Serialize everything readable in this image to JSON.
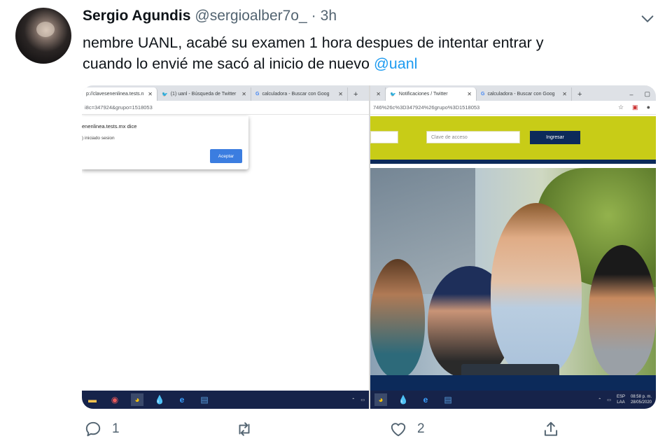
{
  "tweet": {
    "author_name": "Sergio Agundis",
    "handle": "@sergioalber7o_",
    "separator": "·",
    "time": "3h",
    "text_line1": "nembre UANL, acabé su examen 1 hora despues de intentar entrar y",
    "text_line2": "cuando lo envié me sacó al inicio de nuevo",
    "mention": "@uanl"
  },
  "left_screenshot": {
    "tabs": [
      {
        "label": "p://clavesenenlinea.tests.n"
      },
      {
        "label": "(1) uanl - Búsqueda de Twitter"
      },
      {
        "label": "calculadora - Buscar con Goog"
      }
    ],
    "new_tab": "+",
    "address": "i8c=347924&grupo=1518053",
    "dialog": {
      "title": "enenlinea.tests.mx dice",
      "message": ") iniciado sesion",
      "button": "Aceptar"
    }
  },
  "right_screenshot": {
    "tabs": [
      {
        "label": "Notificaciones / Twitter"
      },
      {
        "label": "calculadora - Buscar con Goog"
      }
    ],
    "new_tab": "+",
    "window_controls": [
      "–",
      "▢"
    ],
    "address": "746%26c%3D347924%26grupo%3D1518053",
    "login": {
      "password_placeholder": "Clave de acceso",
      "submit": "Ingresar"
    },
    "taskbar": {
      "lang": "ESP",
      "lang2": "LAA",
      "time": "08:58 p. m.",
      "date": "28/05/2020"
    }
  },
  "actions": {
    "reply_count": "1",
    "like_count": "2"
  },
  "colors": {
    "accent": "#1d9bf0",
    "text": "#0f1419",
    "muted": "#536471",
    "uanl_yellow": "#c8cc17",
    "uanl_navy": "#0c2a5a"
  }
}
